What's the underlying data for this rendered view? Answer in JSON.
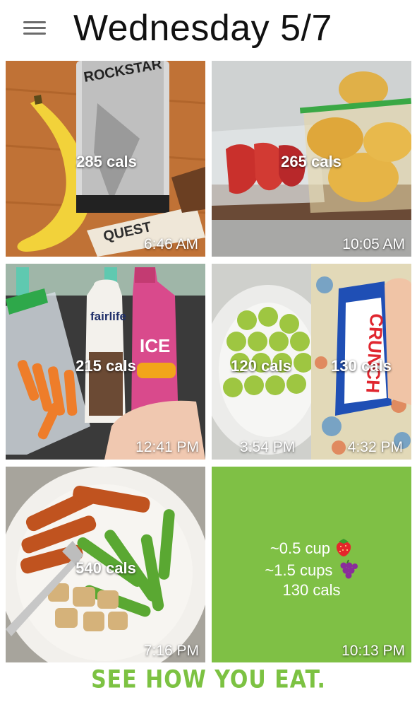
{
  "header": {
    "title": "Wednesday 5/7",
    "menu_icon": "hamburger-menu-icon"
  },
  "entries": [
    {
      "calories": "285 cals",
      "time": "6:46 AM"
    },
    {
      "calories": "265 cals",
      "time": "10:05 AM"
    },
    {
      "calories": "215 cals",
      "time": "12:41 PM"
    },
    {
      "calories": "120 cals",
      "time": "3:54 PM"
    },
    {
      "calories": "130 cals",
      "time": "4:32 PM"
    },
    {
      "calories": "540 cals",
      "time": "7:16 PM"
    },
    {
      "calories": "",
      "time": "10:13 PM",
      "note": {
        "line1": "~0.5 cup",
        "line2": "~1.5 cups",
        "line3": "130 cals"
      }
    }
  ],
  "colors": {
    "accent_green": "#7cc242",
    "note_tile": "#7fc045"
  },
  "footer": {
    "tagline": "SEE HOW YOU EAT."
  }
}
